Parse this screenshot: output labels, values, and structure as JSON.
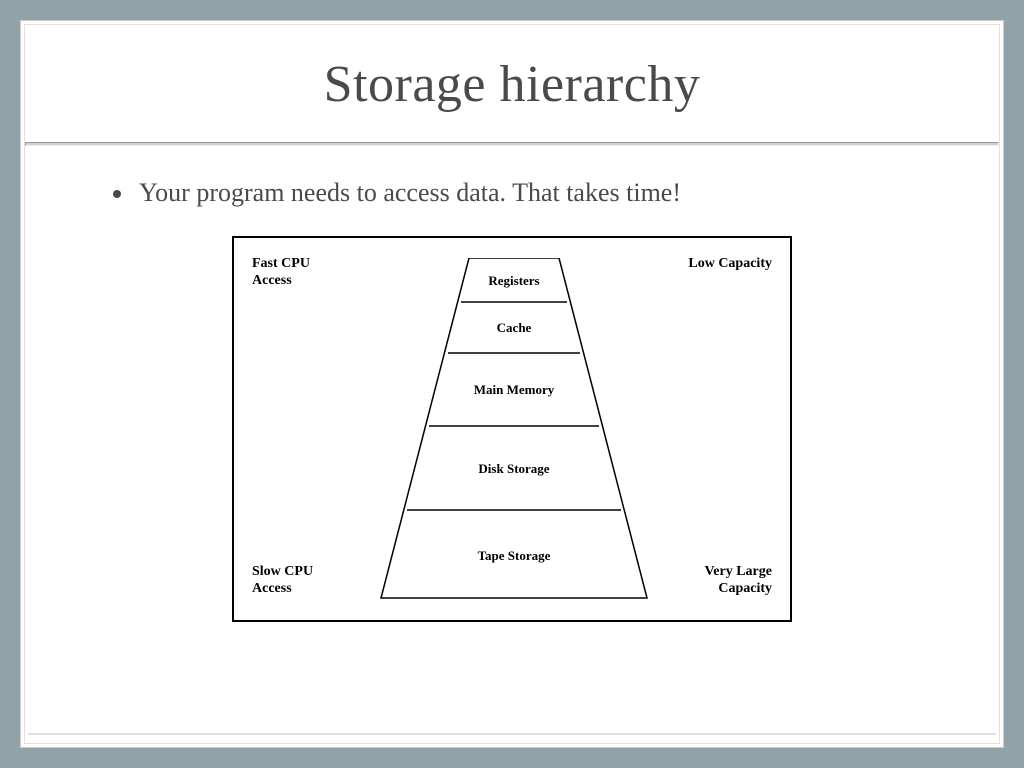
{
  "title": "Storage hierarchy",
  "bullet": "Your program needs to access data. That takes time!",
  "figure": {
    "corners": {
      "topLeft": "Fast CPU\nAccess",
      "topRight": "Low Capacity",
      "bottomLeft": "Slow CPU\nAccess",
      "bottomRight": "Very Large\nCapacity"
    },
    "levels": [
      "Registers",
      "Cache",
      "Main Memory",
      "Disk Storage",
      "Tape Storage"
    ]
  }
}
